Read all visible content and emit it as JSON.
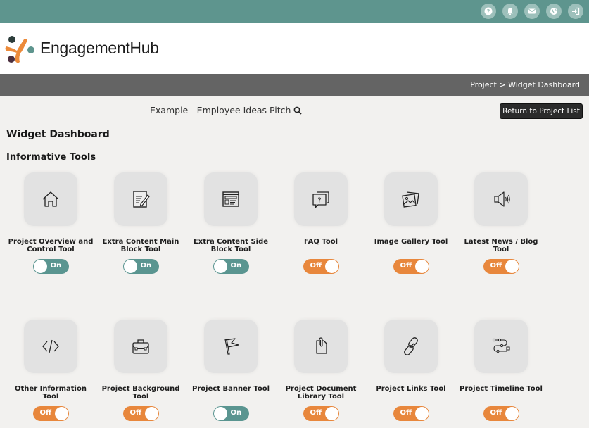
{
  "topbar": {
    "icons": [
      {
        "name": "help-icon"
      },
      {
        "name": "bell-icon"
      },
      {
        "name": "mail-icon"
      },
      {
        "name": "globe-icon"
      },
      {
        "name": "sign-out-icon"
      }
    ]
  },
  "brand": {
    "logo_text": "EngagementHub"
  },
  "breadcrumb": "Project > Widget Dashboard",
  "project": {
    "title": "Example - Employee Ideas Pitch"
  },
  "return_button": "Return to Project List",
  "page_heading": "Widget Dashboard",
  "section_heading": "Informative Tools",
  "colors": {
    "header_teal": "#5e958e",
    "toggle_on": "#5a9590",
    "toggle_off": "#e8873c",
    "crumb_bar": "#646464"
  },
  "tools": [
    {
      "label": "Project Overview and Control Tool",
      "icon": "home-icon",
      "state": "On"
    },
    {
      "label": "Extra Content Main Block Tool",
      "icon": "edit-document-icon",
      "state": "On"
    },
    {
      "label": "Extra Content Side Block Tool",
      "icon": "browser-layout-icon",
      "state": "On"
    },
    {
      "label": "FAQ Tool",
      "icon": "faq-chat-icon",
      "state": "Off"
    },
    {
      "label": "Image Gallery Tool",
      "icon": "image-gallery-icon",
      "state": "Off"
    },
    {
      "label": "Latest News / Blog Tool",
      "icon": "speaker-icon",
      "state": "Off"
    },
    {
      "label": "Other Information Tool",
      "icon": "code-icon",
      "state": "Off"
    },
    {
      "label": "Project Background Tool",
      "icon": "briefcase-icon",
      "state": "Off"
    },
    {
      "label": "Project Banner Tool",
      "icon": "flag-icon",
      "state": "On"
    },
    {
      "label": "Project Document Library Tool",
      "icon": "document-clip-icon",
      "state": "Off"
    },
    {
      "label": "Project Links Tool",
      "icon": "link-icon",
      "state": "Off"
    },
    {
      "label": "Project Timeline Tool",
      "icon": "timeline-icon",
      "state": "Off"
    }
  ]
}
